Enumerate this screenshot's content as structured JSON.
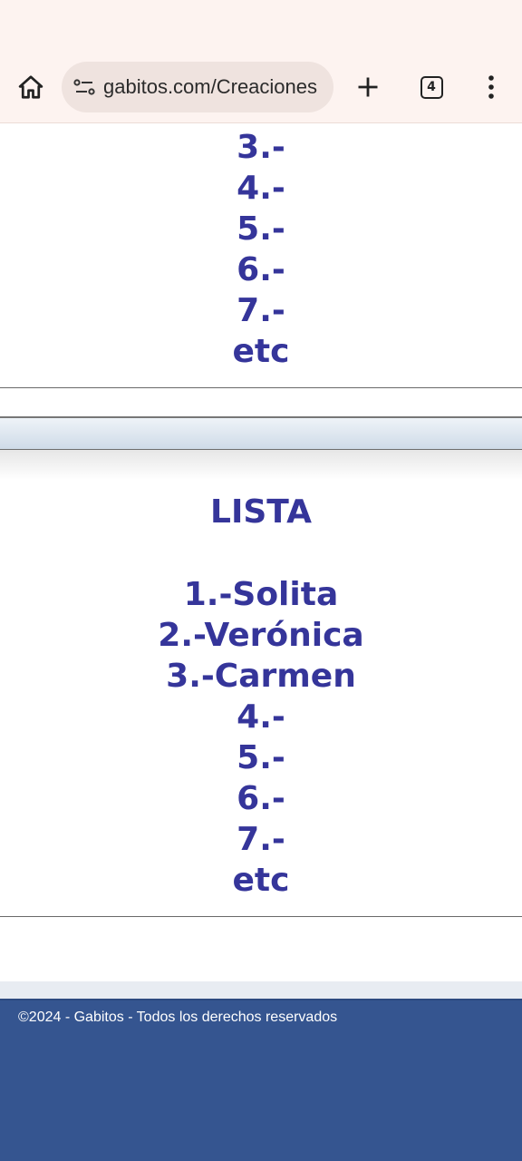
{
  "browser": {
    "url": "gabitos.com/Creaciones",
    "tab_count": "4",
    "icons": [
      "home-icon",
      "site-info-icon",
      "plus-icon",
      "tab-switcher-icon",
      "more-vert-icon"
    ]
  },
  "content": {
    "top_list": [
      "3.-",
      "4.-",
      "5.-",
      "6.-",
      "7.-",
      "etc"
    ],
    "section_title": "LISTA",
    "bottom_list": [
      "1.-Solita",
      "2.-Verónica",
      "3.-Carmen",
      "4.-",
      "5.-",
      "6.-",
      "7.-",
      "etc"
    ]
  },
  "footer": {
    "copyright": "©2024 - Gabitos - Todos los derechos reservados"
  },
  "colors": {
    "text_accent": "#35359a",
    "footer_bg": "#355590",
    "chrome_bg": "#fdf3f0"
  }
}
